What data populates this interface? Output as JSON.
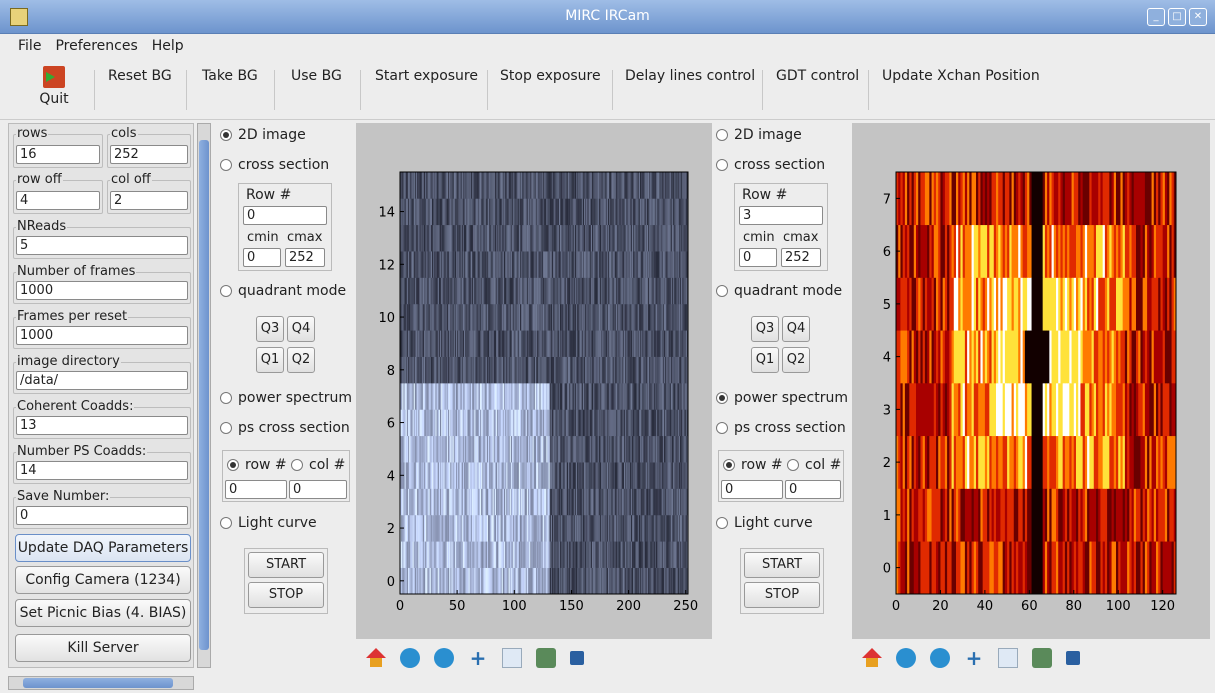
{
  "window": {
    "title": "MIRC IRCam"
  },
  "menu": [
    "File",
    "Preferences",
    "Help"
  ],
  "toolbar": {
    "quit": "Quit",
    "buttons": [
      "Reset BG",
      "Take BG",
      "Use BG",
      "Start exposure",
      "Stop exposure",
      "Delay lines control",
      "GDT control",
      "Update Xchan Position"
    ]
  },
  "params": {
    "rows": {
      "label": "rows",
      "value": "16"
    },
    "cols": {
      "label": "cols",
      "value": "252"
    },
    "row_off": {
      "label": "row off",
      "value": "4"
    },
    "col_off": {
      "label": "col off",
      "value": "2"
    },
    "nreads": {
      "label": "NReads",
      "value": "5"
    },
    "frames": {
      "label": "Number of frames",
      "value": "1000"
    },
    "frames_reset": {
      "label": "Frames per reset",
      "value": "1000"
    },
    "image_dir": {
      "label": "image directory",
      "value": "/data/"
    },
    "coherent": {
      "label": "Coherent Coadds:",
      "value": "13"
    },
    "ps_coadds": {
      "label": "Number PS Coadds:",
      "value": "14"
    },
    "save_number": {
      "label": "Save Number:",
      "value": "0"
    }
  },
  "actions": [
    "Update DAQ Parameters",
    "Config Camera (1234)",
    "Set Picnic Bias (4. BIAS)",
    "Kill Server"
  ],
  "panel_left": {
    "r2d": "2D image",
    "rcross": "cross section",
    "row_label": "Row #",
    "row_value": "0",
    "cmin_label": "cmin",
    "cmax_label": "cmax",
    "cmin": "0",
    "cmax": "252",
    "quad": "quadrant mode",
    "q": [
      "Q3",
      "Q4",
      "Q1",
      "Q2"
    ],
    "power": "power spectrum",
    "pscross": "ps cross section",
    "rowsel": "row #",
    "colsel": "col #",
    "rowv": "0",
    "colv": "0",
    "light": "Light curve",
    "start": "START",
    "stop": "STOP",
    "selected": "2D image"
  },
  "panel_right": {
    "r2d": "2D image",
    "rcross": "cross section",
    "row_label": "Row #",
    "row_value": "3",
    "cmin_label": "cmin",
    "cmax_label": "cmax",
    "cmin": "0",
    "cmax": "252",
    "quad": "quadrant mode",
    "q": [
      "Q3",
      "Q4",
      "Q1",
      "Q2"
    ],
    "power": "power spectrum",
    "pscross": "ps cross section",
    "rowsel": "row #",
    "colsel": "col #",
    "rowv": "0",
    "colv": "0",
    "light": "Light curve",
    "start": "START",
    "stop": "STOP",
    "selected": "power spectrum"
  },
  "chart_data": [
    {
      "type": "heatmap",
      "colormap": "bone",
      "xlim": [
        0,
        252
      ],
      "ylim": [
        -0.5,
        15.5
      ],
      "xticks": [
        "0",
        "50",
        "100",
        "150",
        "200",
        "250"
      ],
      "yticks": [
        "0",
        "2",
        "4",
        "6",
        "8",
        "10",
        "12",
        "14"
      ],
      "rows": 16,
      "cols": 252,
      "bright_region": {
        "rows": [
          0,
          7
        ],
        "cols": [
          0,
          130
        ]
      }
    },
    {
      "type": "heatmap",
      "colormap": "hot",
      "xlim": [
        0,
        126
      ],
      "ylim": [
        -0.5,
        7.5
      ],
      "xticks": [
        "0",
        "20",
        "40",
        "60",
        "80",
        "100",
        "120"
      ],
      "yticks": [
        "0",
        "1",
        "2",
        "3",
        "4",
        "5",
        "6",
        "7"
      ],
      "rows": 8,
      "cols": 126,
      "dark_column": 63,
      "center_peak": {
        "row": 4,
        "col": 63
      }
    }
  ],
  "icons": [
    "home-icon",
    "back-icon",
    "forward-icon",
    "pan-icon",
    "zoom-icon",
    "configure-icon",
    "save-icon"
  ]
}
